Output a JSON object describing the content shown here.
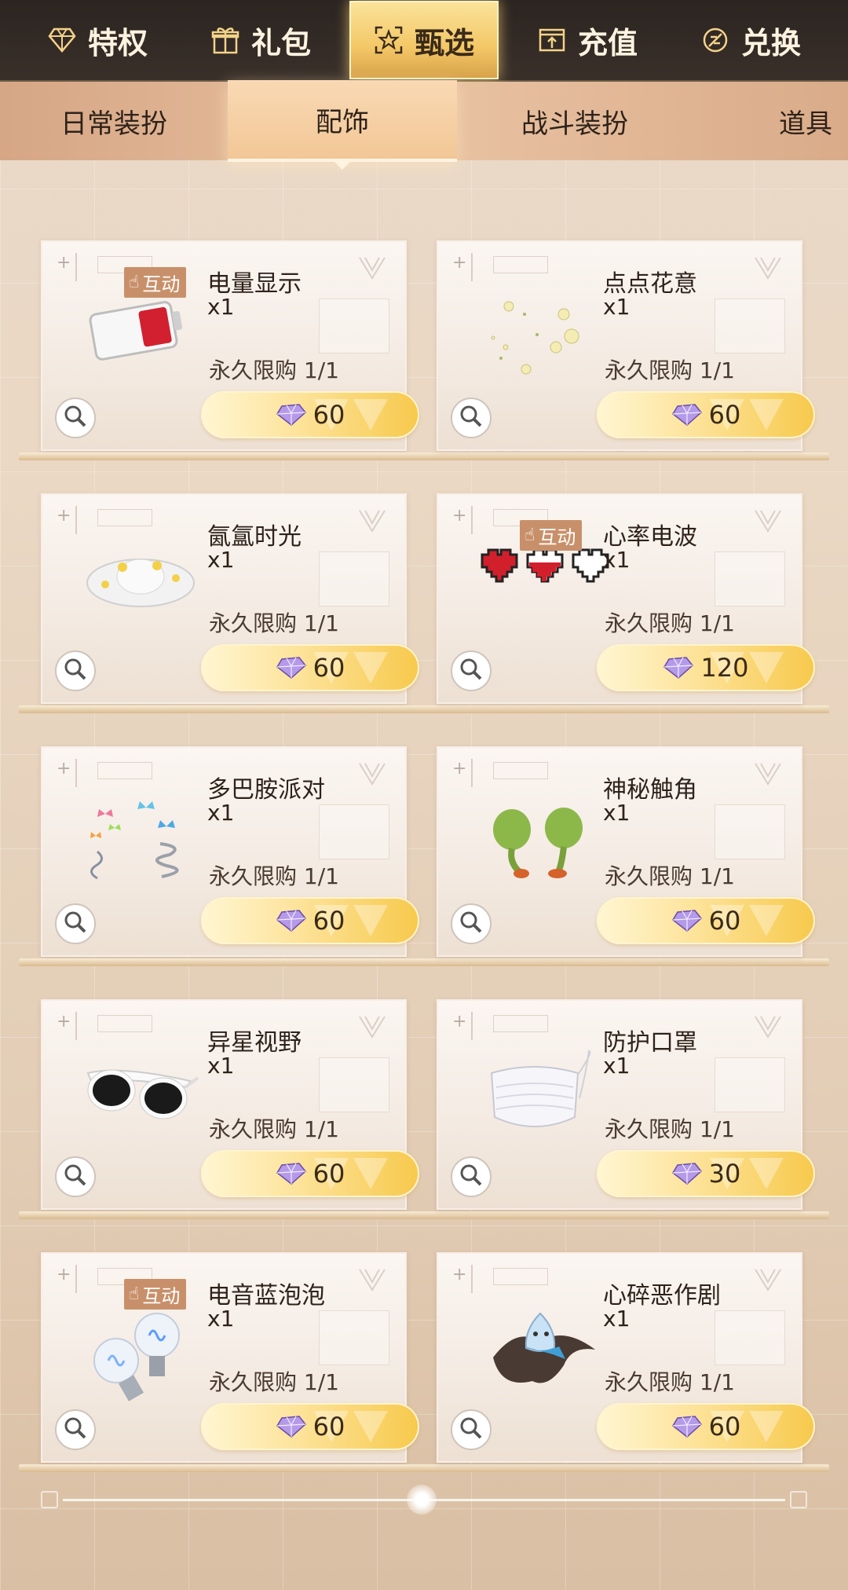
{
  "top_tabs": [
    {
      "label": "特权",
      "icon": "diamond-icon",
      "active": false
    },
    {
      "label": "礼包",
      "icon": "gift-icon",
      "active": false
    },
    {
      "label": "甄选",
      "icon": "star-frame-icon",
      "active": true
    },
    {
      "label": "充值",
      "icon": "upload-box-icon",
      "active": false
    },
    {
      "label": "兑换",
      "icon": "exchange-icon",
      "active": false
    }
  ],
  "sub_tabs": [
    {
      "label": "日常装扮",
      "active": false
    },
    {
      "label": "配饰",
      "active": true
    },
    {
      "label": "战斗装扮",
      "active": false
    },
    {
      "label": "道具",
      "active": false
    }
  ],
  "items": [
    {
      "name": "电量显示",
      "qty": "x1",
      "limit": "永久限购 1/1",
      "price": "60",
      "tag": "互动",
      "image": "battery-icon"
    },
    {
      "name": "点点花意",
      "qty": "x1",
      "limit": "永久限购 1/1",
      "price": "60",
      "tag": "",
      "image": "flowers-icon"
    },
    {
      "name": "氤氲时光",
      "qty": "x1",
      "limit": "永久限购 1/1",
      "price": "60",
      "tag": "",
      "image": "headband-icon"
    },
    {
      "name": "心率电波",
      "qty": "x1",
      "limit": "永久限购 1/1",
      "price": "120",
      "tag": "互动",
      "image": "pixel-hearts-icon"
    },
    {
      "name": "多巴胺派对",
      "qty": "x1",
      "limit": "永久限购 1/1",
      "price": "60",
      "tag": "",
      "image": "butterfly-clips-icon"
    },
    {
      "name": "神秘触角",
      "qty": "x1",
      "limit": "永久限购 1/1",
      "price": "60",
      "tag": "",
      "image": "antennae-icon"
    },
    {
      "name": "异星视野",
      "qty": "x1",
      "limit": "永久限购 1/1",
      "price": "60",
      "tag": "",
      "image": "sunglasses-icon"
    },
    {
      "name": "防护口罩",
      "qty": "x1",
      "limit": "永久限购 1/1",
      "price": "30",
      "tag": "",
      "image": "mask-icon"
    },
    {
      "name": "电音蓝泡泡",
      "qty": "x1",
      "limit": "永久限购 1/1",
      "price": "60",
      "tag": "互动",
      "image": "bulbs-icon"
    },
    {
      "name": "心碎恶作剧",
      "qty": "x1",
      "limit": "永久限购 1/1",
      "price": "60",
      "tag": "",
      "image": "ghost-bird-icon"
    }
  ],
  "colors": {
    "top_bar": "#2b2420",
    "active_gold": "#f3c766",
    "tag_brown": "#c8906a",
    "price_gold": "#f7c94c"
  }
}
